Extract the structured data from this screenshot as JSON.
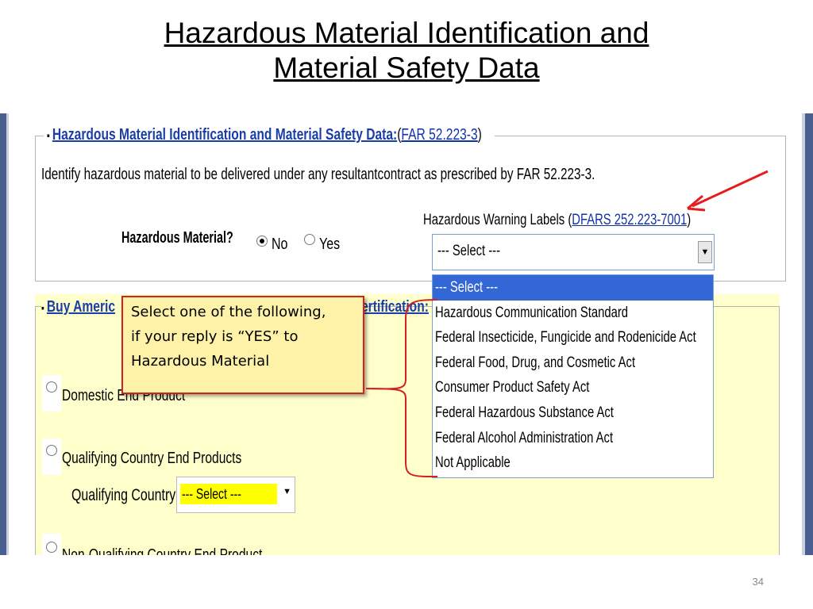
{
  "slide": {
    "title_line1": "Hazardous Material Identification and",
    "title_line2": "Material Safety Data",
    "page_number": "34"
  },
  "section1": {
    "legend_title": "Hazardous Material Identification and Material Safety Data:",
    "legend_link": "FAR 52.223-3",
    "legend_open": "(",
    "legend_close": ")",
    "instruction": "Identify hazardous material to be delivered under any resultantcontract as prescribed by FAR 52.223-3.",
    "hazmat_question": "Hazardous Material?",
    "radio_no": "No",
    "radio_yes": "Yes",
    "radio_selected": "No",
    "labels_caption": "Hazardous Warning Labels (",
    "labels_link": "DFARS 252.223-7001",
    "labels_close": ")",
    "labels_select_value": "--- Select ---"
  },
  "dropdown": {
    "options": [
      "--- Select ---",
      "Hazardous Communication Standard",
      "Federal Insecticide, Fungicide and Rodenicide Act",
      "Federal Food, Drug, and Cosmetic Act",
      "Consumer Product Safety Act",
      "Federal Hazardous Substance Act",
      "Federal Alcohol Administration Act",
      "Not Applicable"
    ],
    "highlighted_index": 0
  },
  "section2": {
    "legend_title_visible_left": "Buy Americ",
    "legend_title_visible_right": "ertification:",
    "option_domestic": "Domestic End Product",
    "option_qualifying": "Qualifying Country End Products",
    "qualifying_country_label": "Qualifying Country:",
    "qualifying_country_value": "--- Select ---",
    "option_non_qualifying": "Non-Qualifying Country End Product"
  },
  "callout": {
    "text_line1": "Select one of the following,",
    "text_line2": "if your reply is “YES” to",
    "text_line3": "Hazardous Material"
  },
  "colors": {
    "link_blue": "#1a3ea8",
    "highlight_blue": "#3367d6",
    "callout_border": "#d42020",
    "callout_fill": "#fdf2a8",
    "section2_fill": "#ffffcc",
    "arrow_red": "#e81c1c",
    "frame_blue": "#4a5f8f"
  }
}
